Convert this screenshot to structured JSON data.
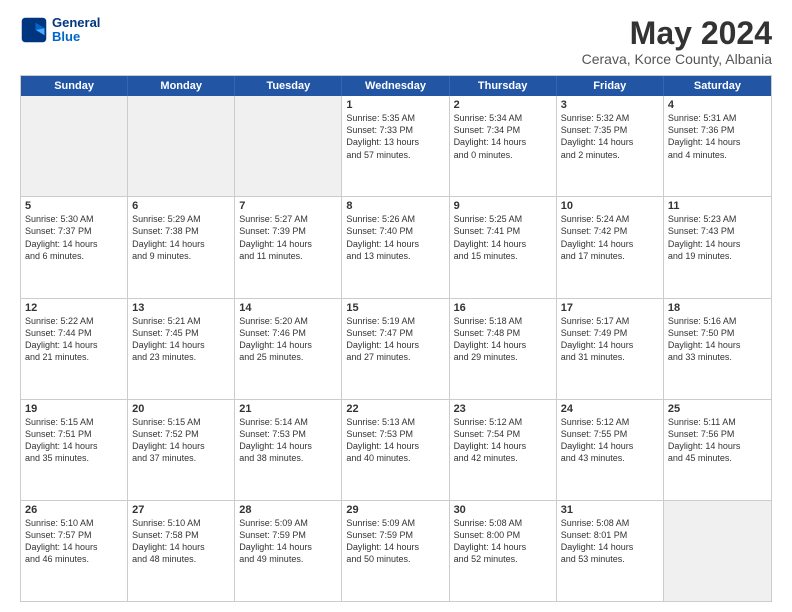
{
  "logo": {
    "line1": "General",
    "line2": "Blue"
  },
  "title": "May 2024",
  "subtitle": "Cerava, Korce County, Albania",
  "header_days": [
    "Sunday",
    "Monday",
    "Tuesday",
    "Wednesday",
    "Thursday",
    "Friday",
    "Saturday"
  ],
  "weeks": [
    [
      {
        "day": "",
        "lines": [],
        "shaded": true
      },
      {
        "day": "",
        "lines": [],
        "shaded": true
      },
      {
        "day": "",
        "lines": [],
        "shaded": true
      },
      {
        "day": "1",
        "lines": [
          "Sunrise: 5:35 AM",
          "Sunset: 7:33 PM",
          "Daylight: 13 hours",
          "and 57 minutes."
        ]
      },
      {
        "day": "2",
        "lines": [
          "Sunrise: 5:34 AM",
          "Sunset: 7:34 PM",
          "Daylight: 14 hours",
          "and 0 minutes."
        ]
      },
      {
        "day": "3",
        "lines": [
          "Sunrise: 5:32 AM",
          "Sunset: 7:35 PM",
          "Daylight: 14 hours",
          "and 2 minutes."
        ]
      },
      {
        "day": "4",
        "lines": [
          "Sunrise: 5:31 AM",
          "Sunset: 7:36 PM",
          "Daylight: 14 hours",
          "and 4 minutes."
        ]
      }
    ],
    [
      {
        "day": "5",
        "lines": [
          "Sunrise: 5:30 AM",
          "Sunset: 7:37 PM",
          "Daylight: 14 hours",
          "and 6 minutes."
        ]
      },
      {
        "day": "6",
        "lines": [
          "Sunrise: 5:29 AM",
          "Sunset: 7:38 PM",
          "Daylight: 14 hours",
          "and 9 minutes."
        ]
      },
      {
        "day": "7",
        "lines": [
          "Sunrise: 5:27 AM",
          "Sunset: 7:39 PM",
          "Daylight: 14 hours",
          "and 11 minutes."
        ]
      },
      {
        "day": "8",
        "lines": [
          "Sunrise: 5:26 AM",
          "Sunset: 7:40 PM",
          "Daylight: 14 hours",
          "and 13 minutes."
        ]
      },
      {
        "day": "9",
        "lines": [
          "Sunrise: 5:25 AM",
          "Sunset: 7:41 PM",
          "Daylight: 14 hours",
          "and 15 minutes."
        ]
      },
      {
        "day": "10",
        "lines": [
          "Sunrise: 5:24 AM",
          "Sunset: 7:42 PM",
          "Daylight: 14 hours",
          "and 17 minutes."
        ]
      },
      {
        "day": "11",
        "lines": [
          "Sunrise: 5:23 AM",
          "Sunset: 7:43 PM",
          "Daylight: 14 hours",
          "and 19 minutes."
        ]
      }
    ],
    [
      {
        "day": "12",
        "lines": [
          "Sunrise: 5:22 AM",
          "Sunset: 7:44 PM",
          "Daylight: 14 hours",
          "and 21 minutes."
        ]
      },
      {
        "day": "13",
        "lines": [
          "Sunrise: 5:21 AM",
          "Sunset: 7:45 PM",
          "Daylight: 14 hours",
          "and 23 minutes."
        ]
      },
      {
        "day": "14",
        "lines": [
          "Sunrise: 5:20 AM",
          "Sunset: 7:46 PM",
          "Daylight: 14 hours",
          "and 25 minutes."
        ]
      },
      {
        "day": "15",
        "lines": [
          "Sunrise: 5:19 AM",
          "Sunset: 7:47 PM",
          "Daylight: 14 hours",
          "and 27 minutes."
        ]
      },
      {
        "day": "16",
        "lines": [
          "Sunrise: 5:18 AM",
          "Sunset: 7:48 PM",
          "Daylight: 14 hours",
          "and 29 minutes."
        ]
      },
      {
        "day": "17",
        "lines": [
          "Sunrise: 5:17 AM",
          "Sunset: 7:49 PM",
          "Daylight: 14 hours",
          "and 31 minutes."
        ]
      },
      {
        "day": "18",
        "lines": [
          "Sunrise: 5:16 AM",
          "Sunset: 7:50 PM",
          "Daylight: 14 hours",
          "and 33 minutes."
        ]
      }
    ],
    [
      {
        "day": "19",
        "lines": [
          "Sunrise: 5:15 AM",
          "Sunset: 7:51 PM",
          "Daylight: 14 hours",
          "and 35 minutes."
        ]
      },
      {
        "day": "20",
        "lines": [
          "Sunrise: 5:15 AM",
          "Sunset: 7:52 PM",
          "Daylight: 14 hours",
          "and 37 minutes."
        ]
      },
      {
        "day": "21",
        "lines": [
          "Sunrise: 5:14 AM",
          "Sunset: 7:53 PM",
          "Daylight: 14 hours",
          "and 38 minutes."
        ]
      },
      {
        "day": "22",
        "lines": [
          "Sunrise: 5:13 AM",
          "Sunset: 7:53 PM",
          "Daylight: 14 hours",
          "and 40 minutes."
        ]
      },
      {
        "day": "23",
        "lines": [
          "Sunrise: 5:12 AM",
          "Sunset: 7:54 PM",
          "Daylight: 14 hours",
          "and 42 minutes."
        ]
      },
      {
        "day": "24",
        "lines": [
          "Sunrise: 5:12 AM",
          "Sunset: 7:55 PM",
          "Daylight: 14 hours",
          "and 43 minutes."
        ]
      },
      {
        "day": "25",
        "lines": [
          "Sunrise: 5:11 AM",
          "Sunset: 7:56 PM",
          "Daylight: 14 hours",
          "and 45 minutes."
        ]
      }
    ],
    [
      {
        "day": "26",
        "lines": [
          "Sunrise: 5:10 AM",
          "Sunset: 7:57 PM",
          "Daylight: 14 hours",
          "and 46 minutes."
        ]
      },
      {
        "day": "27",
        "lines": [
          "Sunrise: 5:10 AM",
          "Sunset: 7:58 PM",
          "Daylight: 14 hours",
          "and 48 minutes."
        ]
      },
      {
        "day": "28",
        "lines": [
          "Sunrise: 5:09 AM",
          "Sunset: 7:59 PM",
          "Daylight: 14 hours",
          "and 49 minutes."
        ]
      },
      {
        "day": "29",
        "lines": [
          "Sunrise: 5:09 AM",
          "Sunset: 7:59 PM",
          "Daylight: 14 hours",
          "and 50 minutes."
        ]
      },
      {
        "day": "30",
        "lines": [
          "Sunrise: 5:08 AM",
          "Sunset: 8:00 PM",
          "Daylight: 14 hours",
          "and 52 minutes."
        ]
      },
      {
        "day": "31",
        "lines": [
          "Sunrise: 5:08 AM",
          "Sunset: 8:01 PM",
          "Daylight: 14 hours",
          "and 53 minutes."
        ]
      },
      {
        "day": "",
        "lines": [],
        "shaded": true
      }
    ]
  ]
}
